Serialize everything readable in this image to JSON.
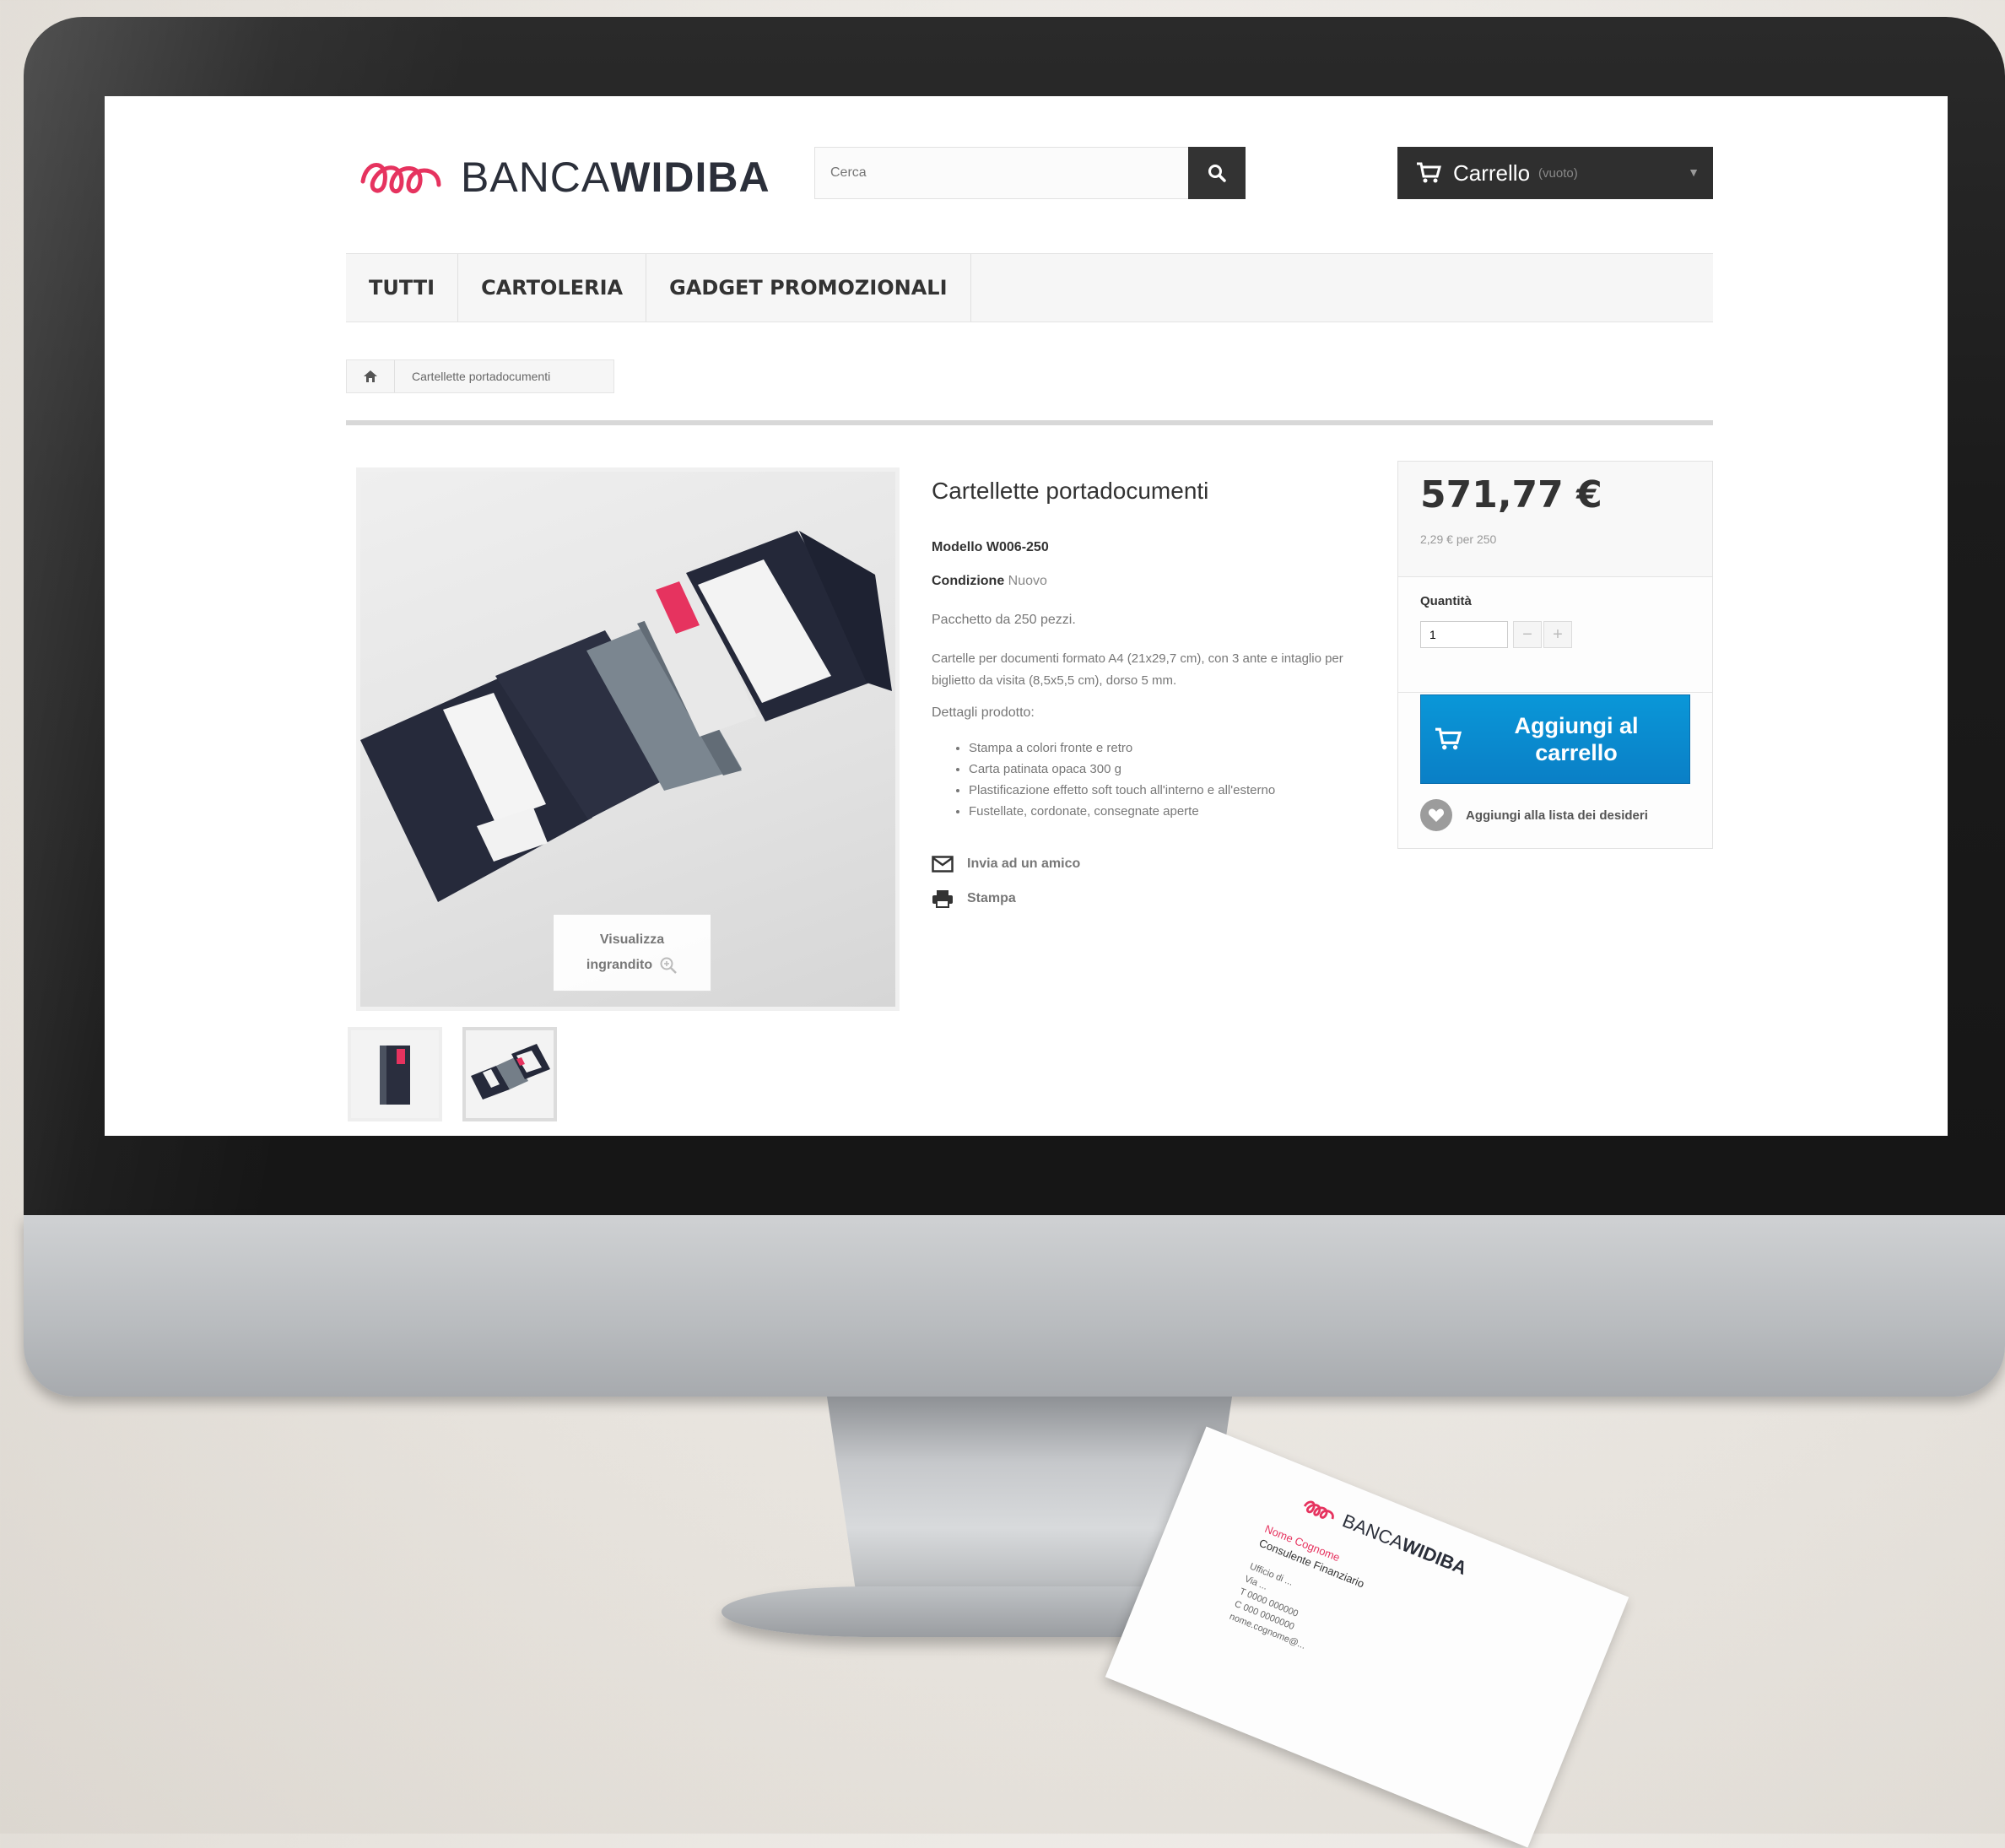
{
  "brand": {
    "name_light": "BANCA",
    "name_bold": "WIDIBA",
    "accent_color": "#e6335f",
    "logo_icon": "widiba-loop-logo"
  },
  "search": {
    "placeholder": "Cerca",
    "button_icon": "search-icon"
  },
  "cart": {
    "label": "Carrello",
    "status": "(vuoto)",
    "icon": "cart-icon"
  },
  "menu": {
    "items": [
      "TUTTI",
      "CARTOLERIA",
      "GADGET PROMOZIONALI"
    ]
  },
  "breadcrumb": {
    "home_icon": "home-icon",
    "current": "Cartellette portadocumenti"
  },
  "product": {
    "title": "Cartellette portadocumenti",
    "model_label": "Modello",
    "model_value": "W006-250",
    "condition_label": "Condizione",
    "condition_value": "Nuovo",
    "package": "Pacchetto da 250 pezzi.",
    "description": "Cartelle per documenti formato A4 (21x29,7 cm), con 3 ante e intaglio per biglietto da visita (8,5x5,5 cm), dorso 5 mm.",
    "details_heading": "Dettagli prodotto:",
    "features": [
      "Stampa a colori fronte e retro",
      "Carta patinata opaca 300 g",
      "Plastificazione effetto soft touch all'interno e all'esterno",
      "Fustellate, cordonate, consegnate aperte"
    ],
    "zoom_line1": "Visualizza",
    "zoom_line2": "ingrandito",
    "send_friend": "Invia ad un amico",
    "print": "Stampa"
  },
  "buy": {
    "price": "571,77 €",
    "unit_price": "2,29 € per 250",
    "quantity_label": "Quantità",
    "quantity_value": "1",
    "add_to_cart_line1": "Aggiungi al",
    "add_to_cart_line2": "carrello",
    "wishlist": "Aggiungi alla lista dei desideri",
    "button_color": "#0a8fd3"
  },
  "business_card": {
    "brand_light": "BANCA",
    "brand_bold": "WIDIBA",
    "person_name": "Nome Cognome",
    "person_role": "Consulente Finanziario",
    "contact_lines": [
      "Ufficio di ...",
      "Via ...",
      "T 0000 000000",
      "C 000 0000000",
      "nome.cognome@..."
    ]
  }
}
